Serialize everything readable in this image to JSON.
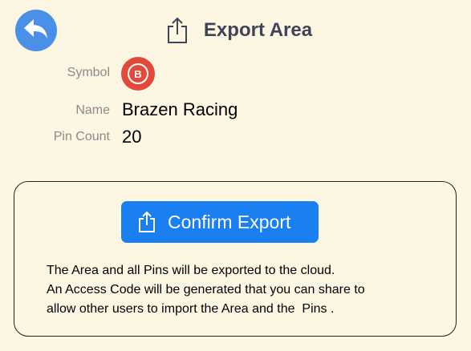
{
  "header": {
    "title": "Export Area",
    "back_icon": "back-arrow-icon",
    "title_icon": "share-icon"
  },
  "info": {
    "symbol_label": "Symbol",
    "symbol_letter": "B",
    "name_label": "Name",
    "name_value": "Brazen Racing",
    "pin_count_label": "Pin Count",
    "pin_count_value": "20"
  },
  "export": {
    "button_label": "Confirm Export",
    "button_icon": "share-icon",
    "description_lines": [
      "The Area and all Pins will be exported to the cloud.",
      "An Access Code will be generated that you can share to",
      "allow other users to import the Area and the  Pins ."
    ]
  },
  "colors": {
    "background": "#fdf6e3",
    "accent": "#1a7ff0",
    "back_button": "#4a90e8",
    "symbol": "#e24a3b"
  }
}
